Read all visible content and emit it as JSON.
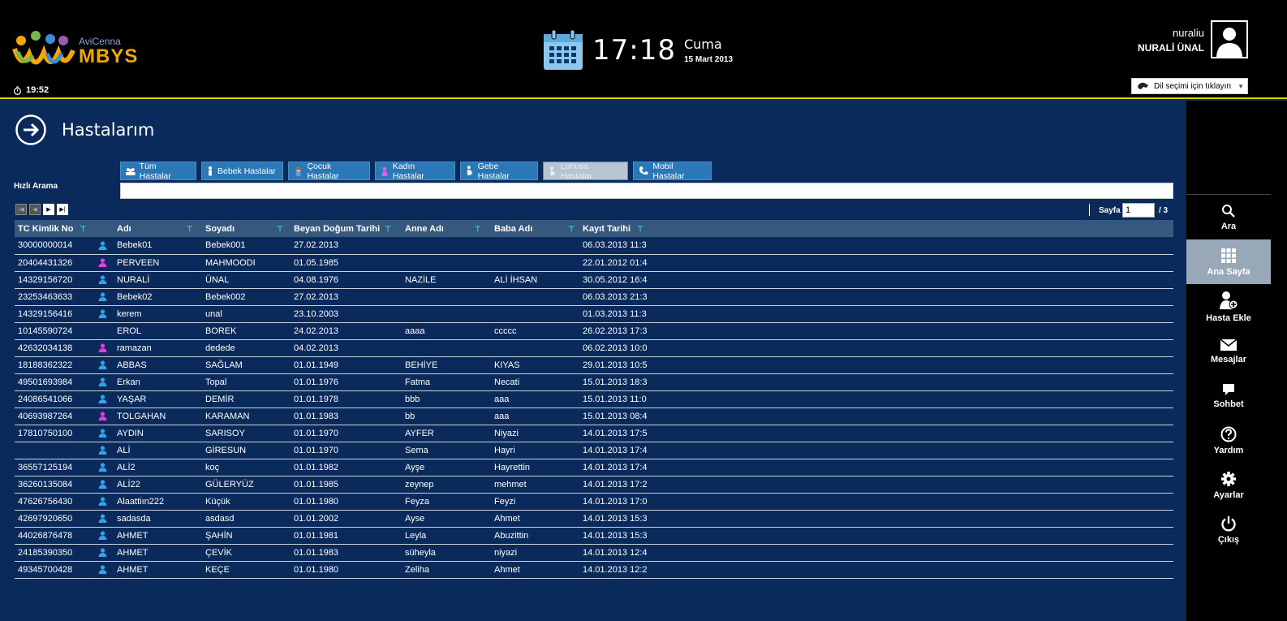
{
  "header": {
    "logo_sub": "AviCenna",
    "logo_main": "MBYS",
    "session_timer": "19:52",
    "time": "17:18",
    "day_name": "Cuma",
    "date": "15 Mart 2013",
    "username": "nuraliu",
    "full_name": "NURALİ ÜNAL",
    "language_select": "Dil seçimi için tıklayın"
  },
  "sidebar": {
    "items": [
      {
        "label": "Ara",
        "icon": "search-icon"
      },
      {
        "label": "Ana Sayfa",
        "icon": "grid-icon",
        "active": true
      },
      {
        "label": "Hasta Ekle",
        "icon": "add-patient-icon"
      },
      {
        "label": "Mesajlar",
        "icon": "mail-icon"
      },
      {
        "label": "Sohbet",
        "icon": "chat-icon"
      },
      {
        "label": "Yardım",
        "icon": "help-icon"
      },
      {
        "label": "Ayarlar",
        "icon": "gear-icon"
      },
      {
        "label": "Çıkış",
        "icon": "power-icon"
      }
    ]
  },
  "main": {
    "title": "Hastalarım",
    "quick_search_label": "Hızlı Arama",
    "search_value": "",
    "filter_tabs": [
      {
        "label": "Tüm Hastalar",
        "icon": "all-patients-icon"
      },
      {
        "label": "Bebek Hastalar",
        "icon": "baby-icon"
      },
      {
        "label": "Çocuk Hastalar",
        "icon": "child-icon"
      },
      {
        "label": "Kadın Hastalar",
        "icon": "woman-icon"
      },
      {
        "label": "Gebe Hastalar",
        "icon": "pregnant-icon"
      },
      {
        "label": "Lohusa Hastalar",
        "icon": "postpartum-icon",
        "disabled": true
      },
      {
        "label": "Mobil Hastalar",
        "icon": "phone-icon"
      }
    ],
    "pager": {
      "label": "Sayfa",
      "current": "1",
      "total": "/ 3"
    },
    "columns": [
      "TC Kimlik No",
      "Adı",
      "Soyadı",
      "Beyan Doğum Tarihi",
      "Anne Adı",
      "Baba Adı",
      "Kayıt Tarihi"
    ],
    "rows": [
      {
        "tc": "30000000014",
        "g": "m",
        "ad": "Bebek01",
        "soyad": "Bebek001",
        "dogum": "27.02.2013",
        "anne": "",
        "baba": "",
        "kayit": "06.03.2013 11:3"
      },
      {
        "tc": "20404431326",
        "g": "f",
        "ad": "PERVEEN",
        "soyad": "MAHMOODI",
        "dogum": "01.05.1985",
        "anne": "",
        "baba": "",
        "kayit": "22.01.2012 01:4"
      },
      {
        "tc": "14329156720",
        "g": "m",
        "ad": "NURALİ",
        "soyad": "ÜNAL",
        "dogum": "04.08.1976",
        "anne": "NAZİLE",
        "baba": "ALİ İHSAN",
        "kayit": "30.05.2012 16:4"
      },
      {
        "tc": "23253463633",
        "g": "m",
        "ad": "Bebek02",
        "soyad": "Bebek002",
        "dogum": "27.02.2013",
        "anne": "",
        "baba": "",
        "kayit": "06.03.2013 21:3"
      },
      {
        "tc": "14329156416",
        "g": "m",
        "ad": "kerem",
        "soyad": "unal",
        "dogum": "23.10.2003",
        "anne": "",
        "baba": "",
        "kayit": "01.03.2013 11:3"
      },
      {
        "tc": "10145590724",
        "g": "",
        "ad": "EROL",
        "soyad": "BOREK",
        "dogum": "24.02.2013",
        "anne": "aaaa",
        "baba": "ccccc",
        "kayit": "26.02.2013 17:3"
      },
      {
        "tc": "42632034138",
        "g": "f",
        "ad": "ramazan",
        "soyad": "dedede",
        "dogum": "04.02.2013",
        "anne": "",
        "baba": "",
        "kayit": "06.02.2013 10:0"
      },
      {
        "tc": "18188362322",
        "g": "m",
        "ad": "ABBAS",
        "soyad": "SAĞLAM",
        "dogum": "01.01.1949",
        "anne": "BEHİYE",
        "baba": "KIYAS",
        "kayit": "29.01.2013 10:5"
      },
      {
        "tc": "49501693984",
        "g": "m",
        "ad": "Erkan",
        "soyad": "Topal",
        "dogum": "01.01.1976",
        "anne": "Fatma",
        "baba": "Necati",
        "kayit": "15.01.2013 18:3"
      },
      {
        "tc": "24086541066",
        "g": "m",
        "ad": "YAŞAR",
        "soyad": "DEMİR",
        "dogum": "01.01.1978",
        "anne": "bbb",
        "baba": "aaa",
        "kayit": "15.01.2013 11:0"
      },
      {
        "tc": "40693987264",
        "g": "f",
        "ad": "TOLGAHAN",
        "soyad": "KARAMAN",
        "dogum": "01.01.1983",
        "anne": "bb",
        "baba": "aaa",
        "kayit": "15.01.2013 08:4"
      },
      {
        "tc": "17810750100",
        "g": "m",
        "ad": "AYDIN",
        "soyad": "SARISOY",
        "dogum": "01.01.1970",
        "anne": "AYFER",
        "baba": "Niyazi",
        "kayit": "14.01.2013 17:5"
      },
      {
        "tc": "",
        "g": "m",
        "ad": "ALİ",
        "soyad": "GİRESUN",
        "dogum": "01.01.1970",
        "anne": "Sema",
        "baba": "Hayri",
        "kayit": "14.01.2013 17:4"
      },
      {
        "tc": "36557125194",
        "g": "m",
        "ad": "ALİ2",
        "soyad": "koç",
        "dogum": "01.01.1982",
        "anne": "Ayşe",
        "baba": "Hayrettin",
        "kayit": "14.01.2013 17:4"
      },
      {
        "tc": "36260135084",
        "g": "m",
        "ad": "ALİ22",
        "soyad": "GÜLERYÜZ",
        "dogum": "01.01.1985",
        "anne": "zeynep",
        "baba": "mehmet",
        "kayit": "14.01.2013 17:2"
      },
      {
        "tc": "47626756430",
        "g": "m",
        "ad": "Alaattiın222",
        "soyad": "Küçük",
        "dogum": "01.01.1980",
        "anne": "Feyza",
        "baba": "Feyzi",
        "kayit": "14.01.2013 17:0"
      },
      {
        "tc": "42697920650",
        "g": "m",
        "ad": "sadasda",
        "soyad": "asdasd",
        "dogum": "01.01.2002",
        "anne": "Ayse",
        "baba": "Ahmet",
        "kayit": "14.01.2013 15:3"
      },
      {
        "tc": "44026876478",
        "g": "m",
        "ad": "AHMET",
        "soyad": "ŞAHİN",
        "dogum": "01.01.1981",
        "anne": "Leyla",
        "baba": "Abuzittin",
        "kayit": "14.01.2013 15:3"
      },
      {
        "tc": "24185390350",
        "g": "m",
        "ad": "AHMET",
        "soyad": "ÇEVİK",
        "dogum": "01.01.1983",
        "anne": "süheyla",
        "baba": "niyazi",
        "kayit": "14.01.2013 12:4"
      },
      {
        "tc": "49345700428",
        "g": "m",
        "ad": "AHMET",
        "soyad": "KEÇE",
        "dogum": "01.01.1980",
        "anne": "Zeliha",
        "baba": "Ahmet",
        "kayit": "14.01.2013 12:2"
      }
    ]
  },
  "colors": {
    "background": "#0a2a5c",
    "header_bg": "#000000",
    "accent_line": "#d8d400",
    "tab_bg": "#2a78b8",
    "male_icon": "#3aa0e8",
    "female_icon": "#e040e0",
    "logo_orange": "#f2a800"
  }
}
